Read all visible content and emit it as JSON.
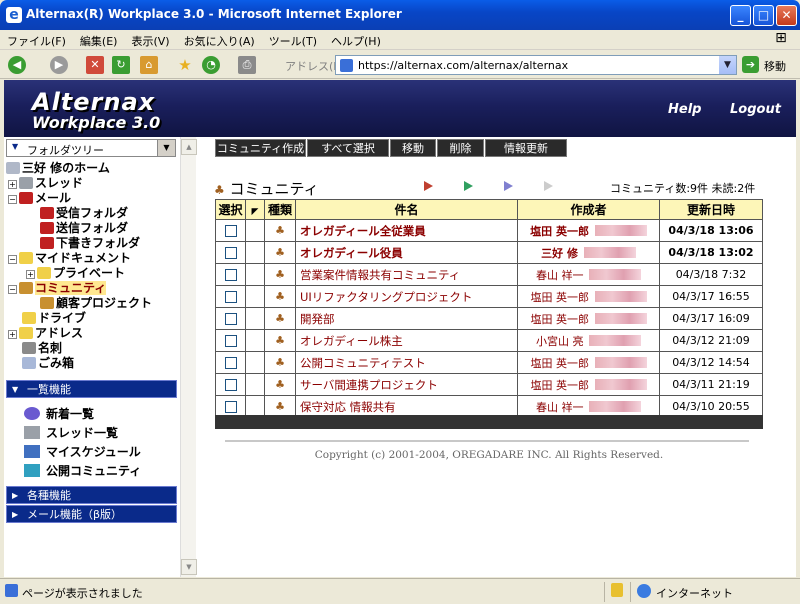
{
  "window": {
    "title": "Alternax(R) Workplace 3.0 - Microsoft Internet Explorer"
  },
  "menu": [
    "ファイル(F)",
    "編集(E)",
    "表示(V)",
    "お気に入り(A)",
    "ツール(T)",
    "ヘルプ(H)"
  ],
  "address": {
    "label": "アドレス(D)",
    "url": "https://alternax.com/alternax/alternax",
    "go": "移動"
  },
  "banner": {
    "line1": "Alternax",
    "line2": "Workplace 3.0",
    "help": "Help",
    "logout": "Logout"
  },
  "sidebar": {
    "folder_tree_label": "フォルダツリー",
    "tree": [
      {
        "label": "三好 修のホーム"
      },
      {
        "label": "スレッド"
      },
      {
        "label": "メール"
      },
      {
        "label": "受信フォルダ"
      },
      {
        "label": "送信フォルダ"
      },
      {
        "label": "下書きフォルダ"
      },
      {
        "label": "マイドキュメント"
      },
      {
        "label": "プライベート"
      },
      {
        "label": "コミュニティ"
      },
      {
        "label": "顧客プロジェクト"
      },
      {
        "label": "ドライブ"
      },
      {
        "label": "アドレス"
      },
      {
        "label": "名刺"
      },
      {
        "label": "ごみ箱"
      }
    ],
    "list_header": "一覧機能",
    "list_items": [
      "新着一覧",
      "スレッド一覧",
      "マイスケジュール",
      "公開コミュニティ"
    ],
    "section2": "各種機能",
    "section3": "メール機能（β版）"
  },
  "actions": [
    "コミュニティ作成",
    "すべて選択",
    "移動",
    "削除",
    "情報更新"
  ],
  "main": {
    "title": "コミュニティ",
    "counts": "コミュニティ数:9件 未読:2件"
  },
  "table": {
    "headers": [
      "選択",
      "",
      "種類",
      "件名",
      "作成者",
      "更新日時"
    ],
    "rows": [
      {
        "name": "オレガディール全従業員",
        "author": "塩田 英一郎",
        "date": "04/3/18 13:06",
        "bold": true
      },
      {
        "name": "オレガディール役員",
        "author": "三好 修",
        "date": "04/3/18 13:02",
        "bold": true
      },
      {
        "name": "営業案件情報共有コミュニティ",
        "author": "春山 祥一",
        "date": "04/3/18 7:32",
        "bold": false
      },
      {
        "name": "UIリファクタリングプロジェクト",
        "author": "塩田 英一郎",
        "date": "04/3/17 16:55",
        "bold": false
      },
      {
        "name": "開発部",
        "author": "塩田 英一郎",
        "date": "04/3/17 16:09",
        "bold": false
      },
      {
        "name": "オレガディール株主",
        "author": "小宮山 亮",
        "date": "04/3/12 21:09",
        "bold": false
      },
      {
        "name": "公開コミュニティテスト",
        "author": "塩田 英一郎",
        "date": "04/3/12 14:54",
        "bold": false
      },
      {
        "name": "サーバ間連携プロジェクト",
        "author": "塩田 英一郎",
        "date": "04/3/11 21:19",
        "bold": false
      },
      {
        "name": "保守対応 情報共有",
        "author": "春山 祥一",
        "date": "04/3/10 20:55",
        "bold": false
      }
    ]
  },
  "footer": {
    "copyright": "Copyright (c) 2001-2004, OREGADARE INC. All Rights Reserved."
  },
  "status": {
    "text": "ページが表示されました",
    "zone": "インターネット"
  }
}
